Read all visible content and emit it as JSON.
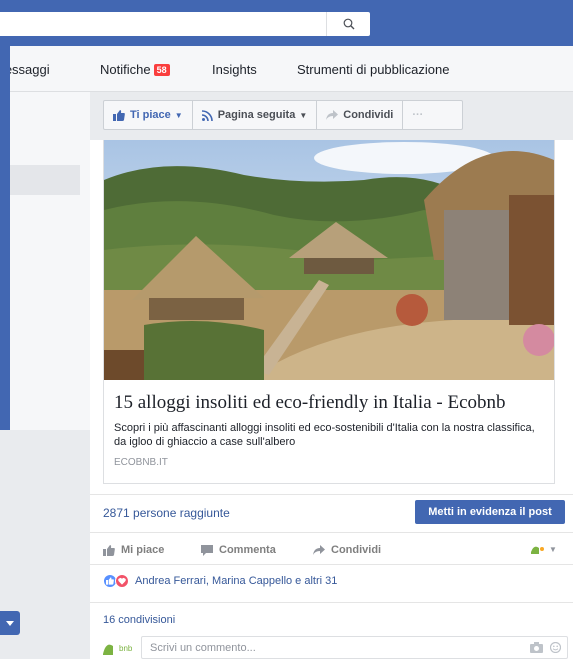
{
  "topbar": {
    "search_placeholder": ""
  },
  "tabs": {
    "messages": "Messaggi",
    "notifications": "Notifiche",
    "notifications_count": "58",
    "insights": "Insights",
    "publishing_tools": "Strumenti di pubblicazione"
  },
  "page_actions": {
    "like": "Ti piace",
    "follow": "Pagina seguita",
    "share": "Condividi",
    "more": "···"
  },
  "post": {
    "link": {
      "title": "15 alloggi insoliti ed eco-friendly in Italia - Ecobnb",
      "description": "Scopri i più affascinanti alloggi insoliti ed eco-sostenibili d'Italia con la nostra classifica, da igloo di ghiaccio a case sull'albero",
      "domain": "ECOBNB.IT"
    },
    "reach": "2871 persone raggiunte",
    "boost_label": "Metti in evidenza il post",
    "feedback": {
      "like": "Mi piace",
      "comment": "Commenta",
      "share": "Condividi"
    },
    "reactions_text": "Andrea Ferrari, Marina Cappello e altri 31",
    "shares": "16 condivisioni",
    "comment_placeholder": "Scrivi un commento...",
    "avatar_text": "bnb"
  },
  "colors": {
    "brand_blue": "#4267b2",
    "link_blue": "#365899",
    "badge_red": "#fa3e3e"
  }
}
